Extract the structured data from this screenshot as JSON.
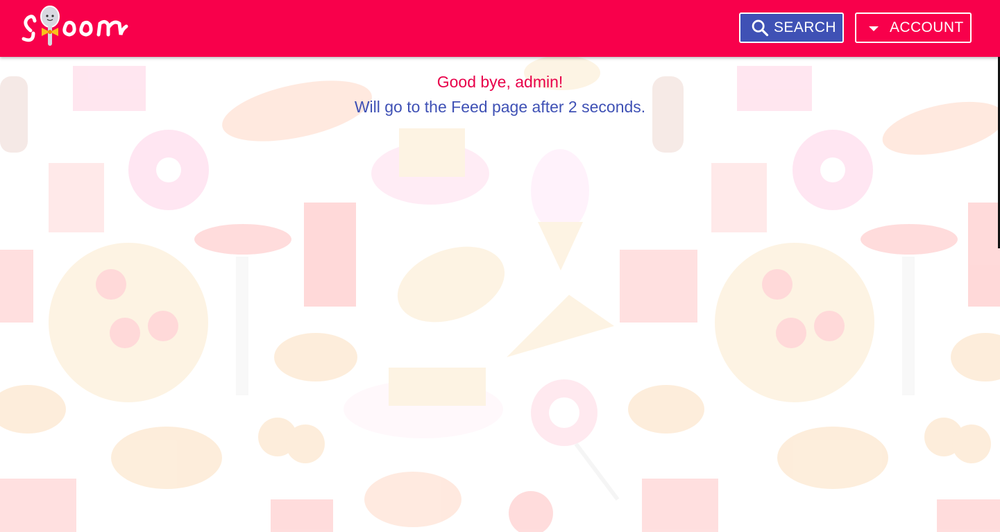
{
  "app": {
    "logo_text": "spoon"
  },
  "header": {
    "search_label": "SEARCH",
    "account_label": "ACCOUNT"
  },
  "main": {
    "goodbye_message": "Good bye, admin!",
    "redirect_message": "Will go to the Feed page after 2 seconds."
  },
  "colors": {
    "brand": "#f8004b",
    "search_button": "#3f51b5",
    "goodbye_text": "#e8004a",
    "redirect_text": "#3f51b5"
  },
  "icons": {
    "search": "search-icon",
    "account": "caret-down-icon",
    "background": "food-pattern"
  }
}
